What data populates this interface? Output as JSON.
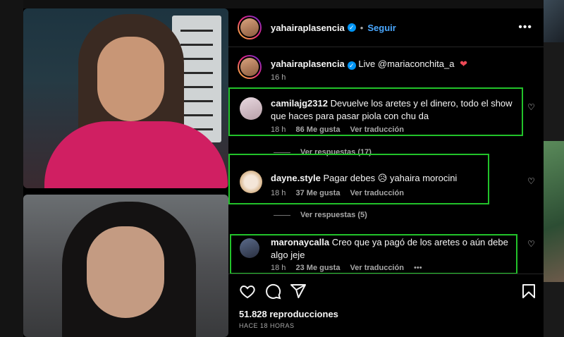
{
  "post": {
    "username": "yahairaplasencia",
    "separator": "•",
    "follow_label": "Seguir",
    "more_label": "•••"
  },
  "caption": {
    "username": "yahairaplasencia",
    "text": "Live @mariaconchita_a",
    "heart": "❤",
    "time": "16 h"
  },
  "comments": [
    {
      "username": "camilajg2312",
      "text": "Devuelve los aretes y el dinero, todo el show que haces para pasar piola con chu da",
      "time": "18 h",
      "likes": "86 Me gusta",
      "translate": "Ver traducción",
      "replies": "Ver respuestas (17)"
    },
    {
      "username": "dayne.style",
      "text": "Pagar debes 😥 yahaira morocini",
      "time": "18 h",
      "likes": "37 Me gusta",
      "translate": "Ver traducción",
      "replies": "Ver respuestas (5)"
    },
    {
      "username": "maronaycalla",
      "text": "Creo que ya pagó de los aretes o aún debe algo jeje",
      "time": "18 h",
      "likes": "23 Me gusta",
      "translate": "Ver traducción",
      "more": "•••"
    }
  ],
  "footer": {
    "views": "51.828 reproducciones",
    "when": "HACE 18 HORAS"
  },
  "icons": {
    "like": "heart-outline-icon",
    "comment": "comment-bubble-icon",
    "share": "paper-plane-icon",
    "save": "bookmark-icon",
    "verified": "verified-badge-icon",
    "more": "more-horizontal-icon"
  },
  "colors": {
    "follow": "#4aa8ff",
    "verified": "#0095f6",
    "highlight_border": "#22c22a",
    "heart": "#ed4956"
  }
}
